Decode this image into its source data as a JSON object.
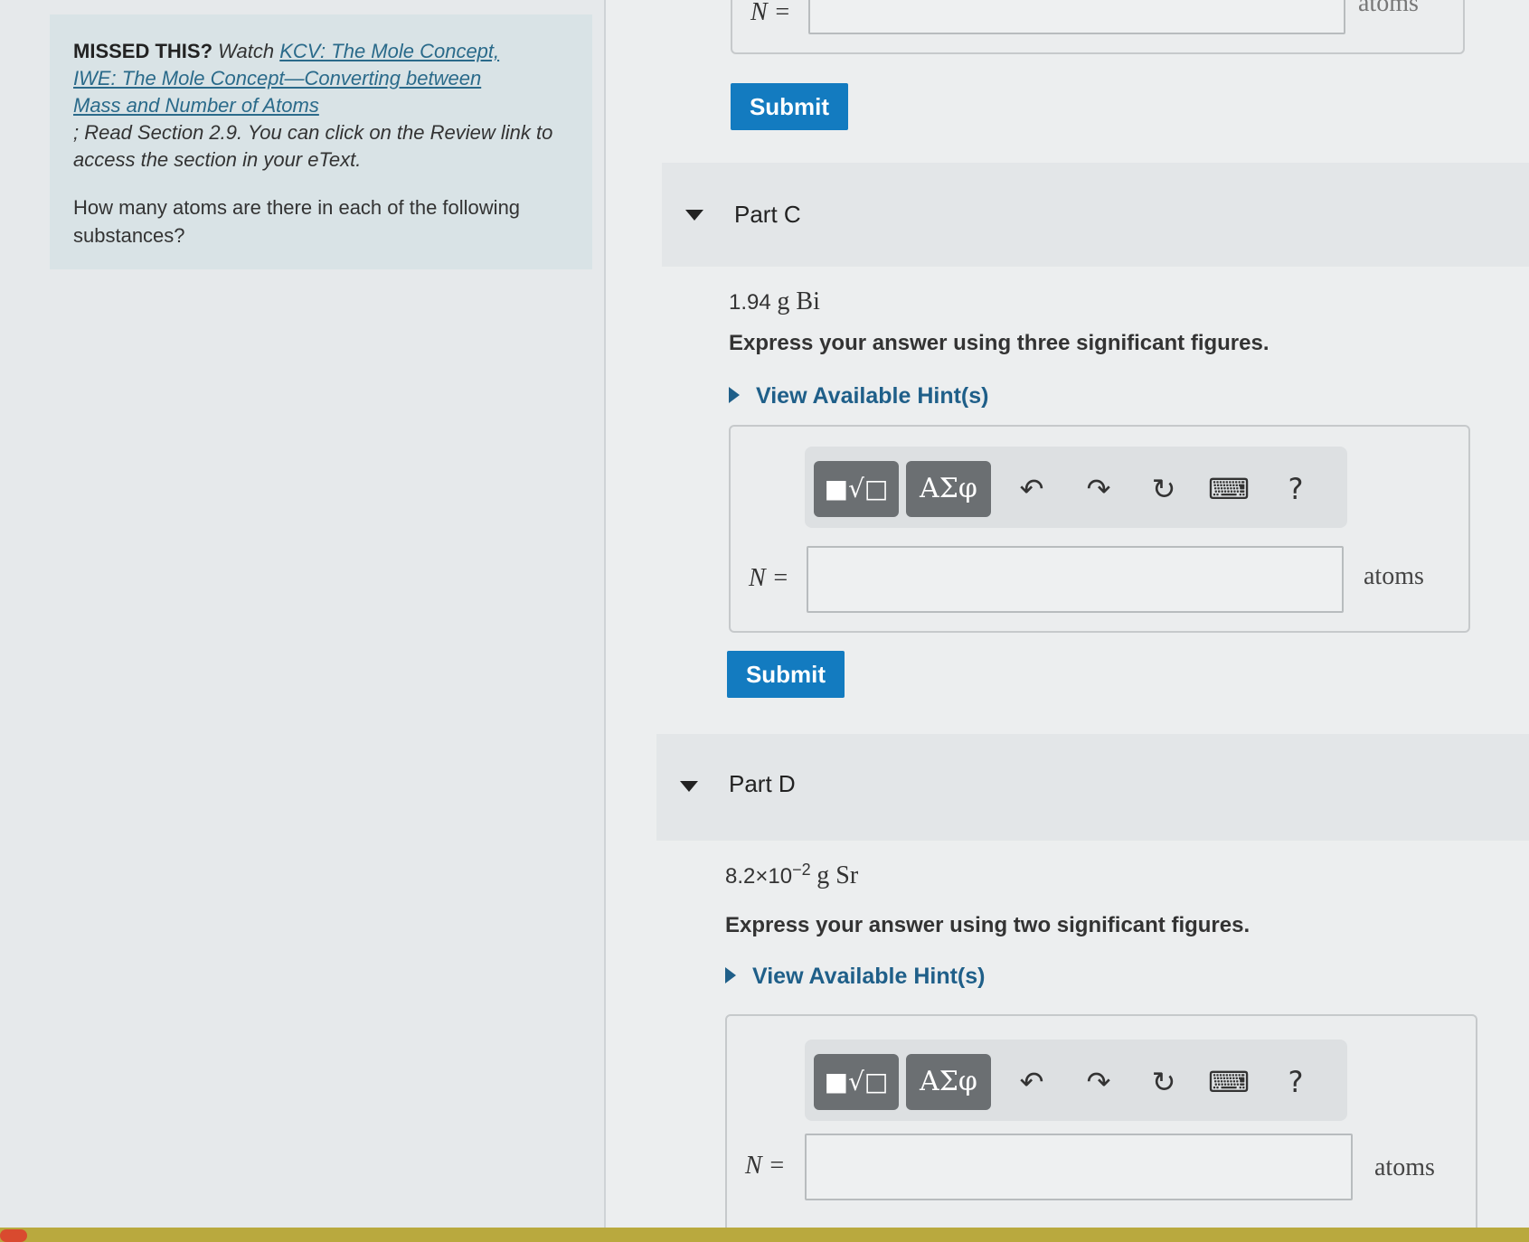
{
  "sidebar": {
    "missed_prefix": "MISSED THIS?",
    "watch": " Watch ",
    "link1": "KCV: The Mole Concept,",
    "link2": "IWE: The Mole Concept—Converting between",
    "link3": "Mass and Number of Atoms",
    "read_text": "; Read Section 2.9. You can click on the Review link to access the section in your eText.",
    "question": "How many atoms are there in each of the following substances?"
  },
  "part_b": {
    "n_label": "N =",
    "unit": "atoms",
    "submit": "Submit"
  },
  "part_c": {
    "title": "Part C",
    "substance_value": "1.94",
    "substance_unit": "g Bi",
    "instruction": "Express your answer using three significant figures.",
    "hint_link": "View Available Hint(s)",
    "toolbar": {
      "template_icon": "■√□",
      "greek_button": "ΑΣφ",
      "undo": "↶",
      "redo": "↷",
      "reset": "↻",
      "keyboard": "⌨",
      "help": "?"
    },
    "n_label": "N =",
    "unit": "atoms",
    "submit": "Submit"
  },
  "part_d": {
    "title": "Part D",
    "substance_mantissa": "8.2×10",
    "substance_exponent": "−2",
    "substance_unit": "g Sr",
    "instruction": "Express your answer using two significant figures.",
    "hint_link": "View Available Hint(s)",
    "toolbar": {
      "template_icon": "■√□",
      "greek_button": "ΑΣφ",
      "undo": "↶",
      "redo": "↷",
      "reset": "↻",
      "keyboard": "⌨",
      "help": "?"
    },
    "n_label": "N =",
    "unit": "atoms"
  }
}
